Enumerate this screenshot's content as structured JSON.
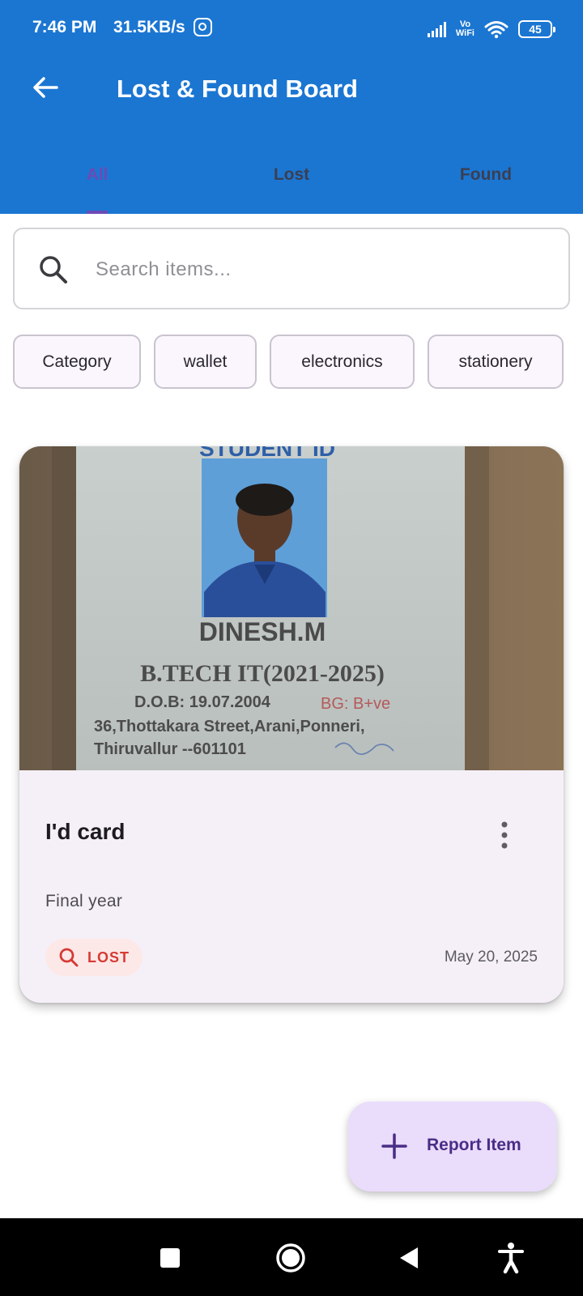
{
  "status_bar": {
    "time": "7:46 PM",
    "network_speed": "31.5KB/s",
    "vowifi_line1": "Vo",
    "vowifi_line2": "WiFi",
    "battery": "45"
  },
  "app_bar": {
    "title": "Lost & Found Board",
    "background_color": "#1b76d2"
  },
  "tabs": [
    {
      "label": "All",
      "active": true
    },
    {
      "label": "Lost",
      "active": false
    },
    {
      "label": "Found",
      "active": false
    }
  ],
  "search": {
    "placeholder": "Search items...",
    "value": ""
  },
  "filter_chips": [
    "Category",
    "wallet",
    "electronics",
    "stationery"
  ],
  "items": [
    {
      "title": "I'd card",
      "description": "Final year",
      "status": "LOST",
      "date": "May 20, 2025",
      "photo_text": {
        "header": "STUDENT ID",
        "name": "DINESH.M",
        "course": "B.TECH IT(2021-2025)",
        "dob": "D.O.B: 19.07.2004",
        "blood_group": "BG: B+ve",
        "address_line1": "36,Thottakara Street,Arani,Ponneri,",
        "address_line2": "Thiruvallur --601101"
      }
    }
  ],
  "fab": {
    "label": "Report Item"
  },
  "colors": {
    "accent": "#6b4bb5",
    "lost_badge_bg": "#fde8e8",
    "lost_badge_text": "#d63b34",
    "fab_bg": "#eadcfb"
  }
}
